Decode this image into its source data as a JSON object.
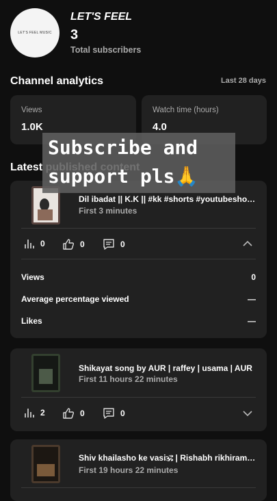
{
  "channel": {
    "avatar_text": "LET'S FEEL MUSIC",
    "name": "LET'S FEEL",
    "subscriber_count": "3",
    "subscriber_label": "Total subscribers"
  },
  "analytics": {
    "title": "Channel analytics",
    "period": "Last 28 days",
    "views_label": "Views",
    "views_value": "1.0K",
    "watch_label": "Watch time (hours)",
    "watch_value": "4.0"
  },
  "latest": {
    "title": "Latest published content",
    "items": [
      {
        "title": "Dil ibadat || K.K || #kk #shorts #youtubeshorts",
        "time": "First 3 minutes",
        "views": "0",
        "likes": "0",
        "comments": "0",
        "expanded": true,
        "details": [
          {
            "label": "Views",
            "value": "0"
          },
          {
            "label": "Average percentage viewed",
            "value": "—"
          },
          {
            "label": "Likes",
            "value": "—"
          }
        ]
      },
      {
        "title": "Shikayat song by AUR | raffey | usama | AUR",
        "time": "First 11 hours 22 minutes",
        "views": "2",
        "likes": "0",
        "comments": "0",
        "expanded": false
      },
      {
        "title": "Shiv khailasho ke vasi🕉 | Rishabh rikhiram sharma",
        "time": "First 19 hours 22 minutes"
      }
    ]
  },
  "overlay": {
    "line1": "Subscribe and",
    "line2": "support pls🙏"
  }
}
